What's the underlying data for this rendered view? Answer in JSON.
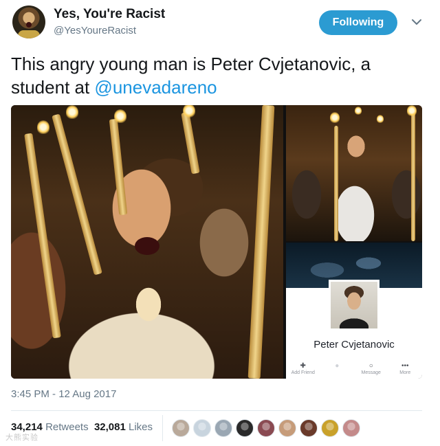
{
  "user": {
    "display_name": "Yes, You're Racist",
    "handle": "@YesYoureRacist"
  },
  "header": {
    "follow_label": "Following"
  },
  "tweet": {
    "text_before": "This angry young man is Peter Cvjetanovic, a student at ",
    "mention": "@unevadareno",
    "timestamp": "3:45 PM - 12 Aug 2017"
  },
  "profile_card": {
    "name": "Peter Cvjetanovic",
    "actions": [
      {
        "label": "Add Friend",
        "icon": "add-friend-icon"
      },
      {
        "label": "",
        "icon": "follow-icon"
      },
      {
        "label": "Message",
        "icon": "messenger-icon"
      },
      {
        "label": "More",
        "icon": "more-icon"
      }
    ]
  },
  "stats": {
    "retweets_count": "34,214",
    "retweets_label": "Retweets",
    "likes_count": "32,081",
    "likes_label": "Likes"
  },
  "likers": [
    {
      "color": "#b9a99a"
    },
    {
      "color": "#c8d4de"
    },
    {
      "color": "#9aa7b3"
    },
    {
      "color": "#2a2a2a"
    },
    {
      "color": "#8a4a52"
    },
    {
      "color": "#c69c7a"
    },
    {
      "color": "#6a3a2a"
    },
    {
      "color": "#c9a12a"
    },
    {
      "color": "#c48a8a"
    }
  ],
  "watermark": "大熊实验"
}
